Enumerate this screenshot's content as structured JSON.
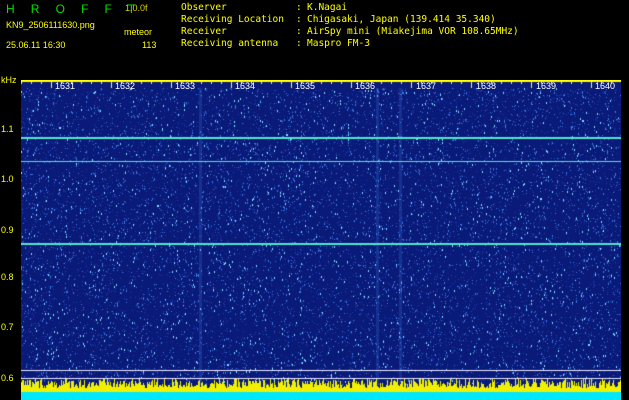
{
  "header": {
    "brand": "H R O F F T",
    "version": "1.0.0f",
    "filename": "KN9_2506111630.png",
    "mode": "meteor",
    "datetime": "25.06.11 16:30",
    "count": "113"
  },
  "info": {
    "rows": [
      {
        "label": "Observer",
        "value": "K.Nagai"
      },
      {
        "label": "Receiving Location",
        "value": "Chigasaki, Japan (139.414 35.340)"
      },
      {
        "label": "Receiver",
        "value": "AirSpy mini (Miakejima VOR 108.65MHz)"
      },
      {
        "label": "Receiving antenna",
        "value": "Maspro FM-3"
      }
    ],
    "separator": ":"
  },
  "spectrogram": {
    "y_unit": "kHz",
    "y_ticks": [
      "1.1",
      "1.0",
      "0.9",
      "0.8",
      "0.7",
      "0.6"
    ],
    "x_ticks": [
      "1631",
      "1632",
      "1633",
      "1634",
      "1635",
      "1636",
      "1637",
      "1638",
      "1639",
      "1640"
    ],
    "y_range_khz": [
      0.59,
      1.2
    ],
    "x_range_min": [
      1630.5,
      1640.5
    ],
    "carrier_lines_khz": [
      1.1,
      1.05,
      0.882
    ],
    "reference_lines_khz": [
      0.62,
      0.605
    ],
    "colors": {
      "background": "#0a1a78",
      "noise_light": "#3a78e0",
      "noise_bright": "#7fe0ff",
      "carrier": "#4fe8c8",
      "reference": "#e8e8ff",
      "bottom_bar_yellow": "#f0f000",
      "bottom_bar_cyan": "#00e8ff",
      "tick_mark": "#ffff00"
    }
  }
}
